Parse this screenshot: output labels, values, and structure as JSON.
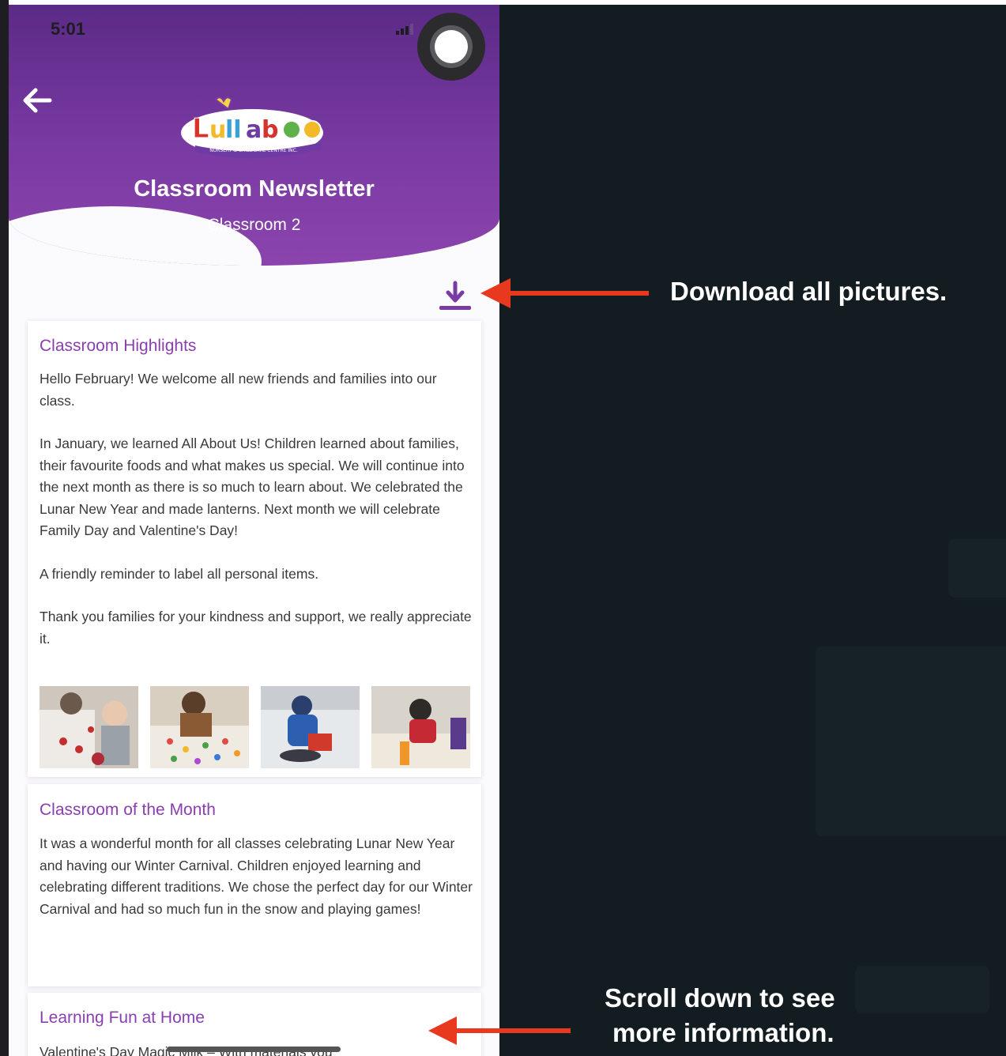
{
  "status_bar": {
    "time": "5:01"
  },
  "header": {
    "logo_text": "Lullaboo",
    "logo_subtext": "NURSERY & CHILDCARE CENTRE INC.",
    "title": "Classroom Newsletter",
    "subtitle": "Classroom 2"
  },
  "icons": {
    "back": "back-arrow-icon",
    "download": "download-icon",
    "record": "screen-record-icon"
  },
  "sections": [
    {
      "title": "Classroom Highlights",
      "paragraphs": [
        "Hello February! We welcome all new friends and families into our class.",
        "In January, we learned All About Us! Children learned about families, their favourite foods and what makes us special. We will continue into the next month as there is so much to learn about. We celebrated the Lunar New Year and made lanterns. Next month we will celebrate Family Day and Valentine's Day!",
        "A friendly reminder to label all personal items.",
        "Thank you families for your kindness and support, we really appreciate it."
      ],
      "photo_count": 4
    },
    {
      "title": "Classroom of the Month",
      "paragraphs": [
        "It was a wonderful month for all classes celebrating Lunar New Year and having our Winter Carnival. Children enjoyed learning and celebrating different traditions. We chose the perfect day for our Winter Carnival and had so much fun in the snow and playing games!"
      ]
    },
    {
      "title": "Learning Fun at Home",
      "paragraphs": [
        "Valentine's Day Magic Milk – With materials you"
      ]
    }
  ],
  "annotations": {
    "download": "Download all pictures.",
    "scroll_line1": "Scroll down to see",
    "scroll_line2": "more information."
  },
  "colors": {
    "brand_purple": "#7a3aa3",
    "heading_purple": "#8a3fb0",
    "annotation_arrow": "#e8391f",
    "dark_background": "#131c20"
  }
}
